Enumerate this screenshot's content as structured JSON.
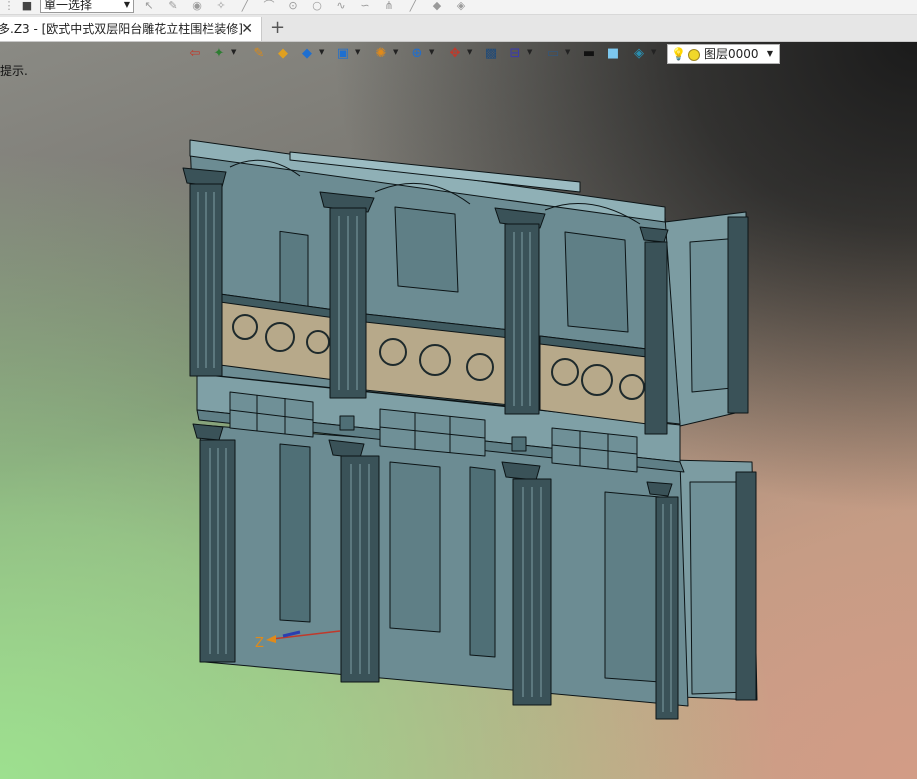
{
  "toolbar": {
    "select_mode": "單一选择"
  },
  "tab": {
    "title": "多.Z3 - [欧式中式双层阳台雕花立柱围栏装修]",
    "close": "✕",
    "new_tab": "+"
  },
  "viewport": {
    "hint": "提示.",
    "axis_label": "Z",
    "layer": {
      "name": "图层0000"
    }
  },
  "icons": [
    "pointer-icon",
    "wrench-icon",
    "circle-icon",
    "sketch-icon",
    "line-icon",
    "arc-icon",
    "curve-icon",
    "spline-icon",
    "trim-icon",
    "measure-icon",
    "paint-icon"
  ],
  "colors": {
    "model_fill": "#5f7f86",
    "model_edge": "#0c1416",
    "carving": "#b7a98a"
  }
}
